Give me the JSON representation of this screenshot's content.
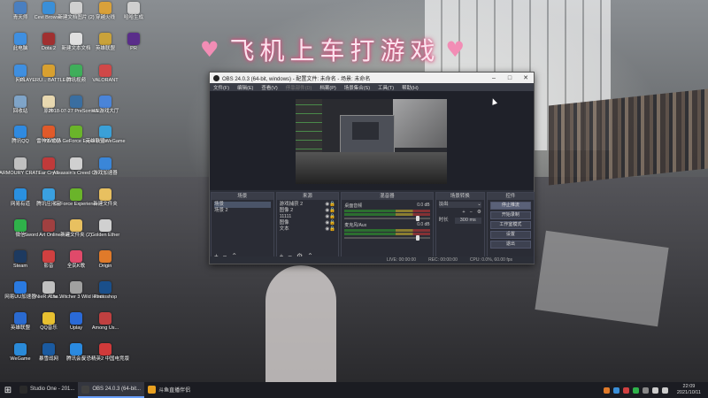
{
  "wallpaper_text": "飞机上车打游戏",
  "desktop_icons": [
    {
      "label": "青天师",
      "color": "#4a7fc0"
    },
    {
      "label": "Cevi Browser",
      "color": "#3a8fd8"
    },
    {
      "label": "新建文档图片 (2)",
      "color": "#d0d0d0"
    },
    {
      "label": "穿越火线",
      "color": "#d9a13a"
    },
    {
      "label": "哈哈生成",
      "color": "#cfcfcf"
    },
    {
      "label": "此电脑",
      "color": "#3f8fe0"
    },
    {
      "label": "Dota 2",
      "color": "#a03030"
    },
    {
      "label": "新建文本文档",
      "color": "#e0e0e0"
    },
    {
      "label": "英雄联盟",
      "color": "#c9a23a"
    },
    {
      "label": "PR",
      "color": "#5a2d8a"
    },
    {
      "label": "网络",
      "color": "#3f8fe0"
    },
    {
      "label": "PLAYERU... BATTLEGR...",
      "color": "#d8a030"
    },
    {
      "label": "腾讯视频",
      "color": "#3fae5a"
    },
    {
      "label": "VALORANT",
      "color": "#d04848"
    },
    {
      "label": "回收站",
      "color": "#7fa4c8"
    },
    {
      "label": "原神",
      "color": "#e8d8b0"
    },
    {
      "label": "2018-07-27 PreSomatic...",
      "color": "#3a6ea0"
    },
    {
      "label": "WE游戏大厅",
      "color": "#4a84d8"
    },
    {
      "label": "腾讯QQ",
      "color": "#2f8ae0"
    },
    {
      "label": "雷神加速器",
      "color": "#e05a2a"
    },
    {
      "label": "NVIDIA GeForce Experience",
      "color": "#6ab42a"
    },
    {
      "label": "英雄联盟WeGame",
      "color": "#3aa0d8"
    },
    {
      "label": "ARMOURY CRATE",
      "color": "#c0c0c0"
    },
    {
      "label": "Far Cry 5",
      "color": "#c03a3a"
    },
    {
      "label": "Assassin's Creed O...",
      "color": "#d0d0d0"
    },
    {
      "label": "游戏加速器",
      "color": "#3a86d8"
    },
    {
      "label": "网易有道",
      "color": "#2a90e0"
    },
    {
      "label": "腾讯应用宝",
      "color": "#3aa0e0"
    },
    {
      "label": "GeForce Experience",
      "color": "#6ab42a"
    },
    {
      "label": "新建文件夹",
      "color": "#e8c060"
    },
    {
      "label": "微信",
      "color": "#2fb24a"
    },
    {
      "label": "Sword Art Online Fat...",
      "color": "#a04040"
    },
    {
      "label": "新建文件夹 (2)",
      "color": "#e8c060"
    },
    {
      "label": "Golden Ether",
      "color": "#d0d0d0"
    },
    {
      "label": "Steam",
      "color": "#1d3a60"
    },
    {
      "label": "影音",
      "color": "#d04040"
    },
    {
      "label": "全民K歌",
      "color": "#e04a6a"
    },
    {
      "label": "Origin",
      "color": "#e07a2a"
    },
    {
      "label": "网易UU加速器",
      "color": "#2a7ae0"
    },
    {
      "label": "NieR:Auto...",
      "color": "#c0c0c0"
    },
    {
      "label": "The Witcher 3 Wild Hunt",
      "color": "#a0a0a0"
    },
    {
      "label": "Photoshop",
      "color": "#1a4f8a"
    },
    {
      "label": "英雄联盟",
      "color": "#2a6ad0"
    },
    {
      "label": "QQ音乐",
      "color": "#e8c030"
    },
    {
      "label": "Uplay",
      "color": "#2a6ad8"
    },
    {
      "label": "Among Us...",
      "color": "#c04040"
    },
    {
      "label": "WeGame",
      "color": "#2a8ad8"
    },
    {
      "label": "暴雪战网",
      "color": "#1a5aa0"
    },
    {
      "label": "腾讯会议",
      "color": "#2a8ae0"
    },
    {
      "label": "反恐精英2 中国电竞版",
      "color": "#d03a3a"
    }
  ],
  "obs": {
    "title": "OBS 24.0.3 (64-bit, windows) - 配置文件: 未命名 - 场景: 未命名",
    "menu": [
      "文件(F)",
      "编辑(E)",
      "查看(V)",
      "停靠部件(D)",
      "档案(P)",
      "场景集合(S)",
      "工具(T)",
      "帮助(H)"
    ],
    "docks": {
      "scenes": {
        "title": "场景",
        "items": [
          "场景",
          "场景 2"
        ]
      },
      "sources": {
        "title": "来源",
        "items": [
          "游戏捕获 2",
          "图像 2",
          "11111",
          "图像",
          "文本"
        ]
      },
      "mixer": {
        "title": "混音器",
        "channels": [
          {
            "name": "桌面音频",
            "db": "0.0 dB"
          },
          {
            "name": "麦克风/Aux",
            "db": "0.0 dB"
          }
        ]
      },
      "transitions": {
        "title": "场景转换",
        "type": "淡出",
        "duration_label": "时长",
        "duration": "300 ms"
      },
      "controls": {
        "title": "控件",
        "buttons": [
          "停止推流",
          "开始录制",
          "工作室模式",
          "设置",
          "退出"
        ]
      }
    },
    "status": {
      "live": "LIVE: 00:00:00",
      "rec": "REC: 00:00:00",
      "cpu": "CPU: 0.0%, 60.00 fps"
    }
  },
  "taskbar": {
    "items": [
      {
        "label": "Studio One - 201...",
        "color": "#2a2a2a"
      },
      {
        "label": "OBS 24.0.3 (64-bit...",
        "color": "#404040"
      },
      {
        "label": "斗鱼直播伴侣",
        "color": "#e8a020"
      }
    ],
    "time": "22:09",
    "date": "2021/10/11"
  }
}
